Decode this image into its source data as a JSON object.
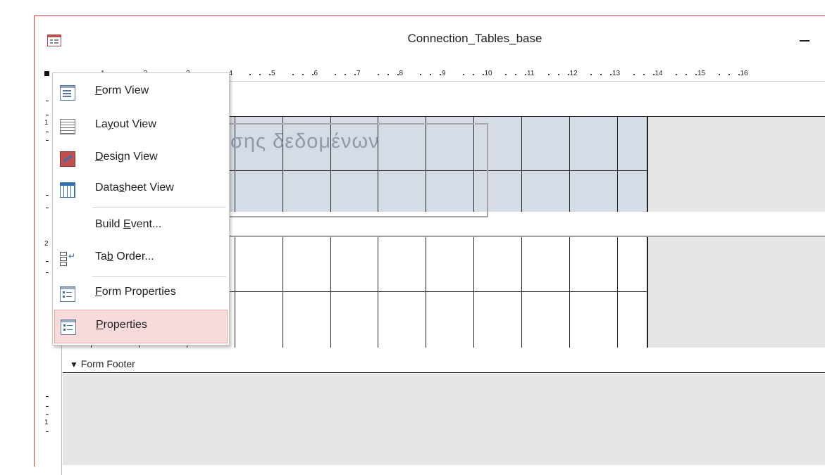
{
  "window": {
    "title": "Connection_Tables_base",
    "minimize_label": "–"
  },
  "ruler": {
    "numbers": [
      "1",
      "2",
      "3",
      "4",
      "5",
      "6",
      "7",
      "8",
      "9",
      "10",
      "11",
      "12",
      "13",
      "14",
      "15",
      "16"
    ]
  },
  "vruler_numbers": [
    "1",
    "2",
    "1"
  ],
  "design": {
    "header_label_text": "σης δεδομένων",
    "form_footer_label": "Form Footer"
  },
  "context_menu": {
    "items": [
      {
        "label_pre": "",
        "accel": "F",
        "label_post": "orm View",
        "icon": "form-view-icon"
      },
      {
        "label_pre": "La",
        "accel": "y",
        "label_post": "out View",
        "icon": "layout-view-icon"
      },
      {
        "label_pre": "",
        "accel": "D",
        "label_post": "esign View",
        "icon": "design-view-icon"
      },
      {
        "label_pre": "Data",
        "accel": "s",
        "label_post": "heet View",
        "icon": "datasheet-view-icon"
      },
      {
        "label_pre": "Build ",
        "accel": "E",
        "label_post": "vent...",
        "icon": ""
      },
      {
        "label_pre": "Ta",
        "accel": "b",
        "label_post": " Order...",
        "icon": "tab-order-icon"
      },
      {
        "label_pre": "",
        "accel": "F",
        "label_post": "orm Properties",
        "icon": "form-properties-icon"
      },
      {
        "label_pre": "",
        "accel": "P",
        "label_post": "roperties",
        "icon": "properties-icon"
      }
    ],
    "selected_index": 7
  },
  "colors": {
    "accent": "#d9363e",
    "selection_bg": "#f9dadb",
    "header_section_bg": "#d6dce6",
    "empty_area_bg": "#e6e6e6"
  }
}
